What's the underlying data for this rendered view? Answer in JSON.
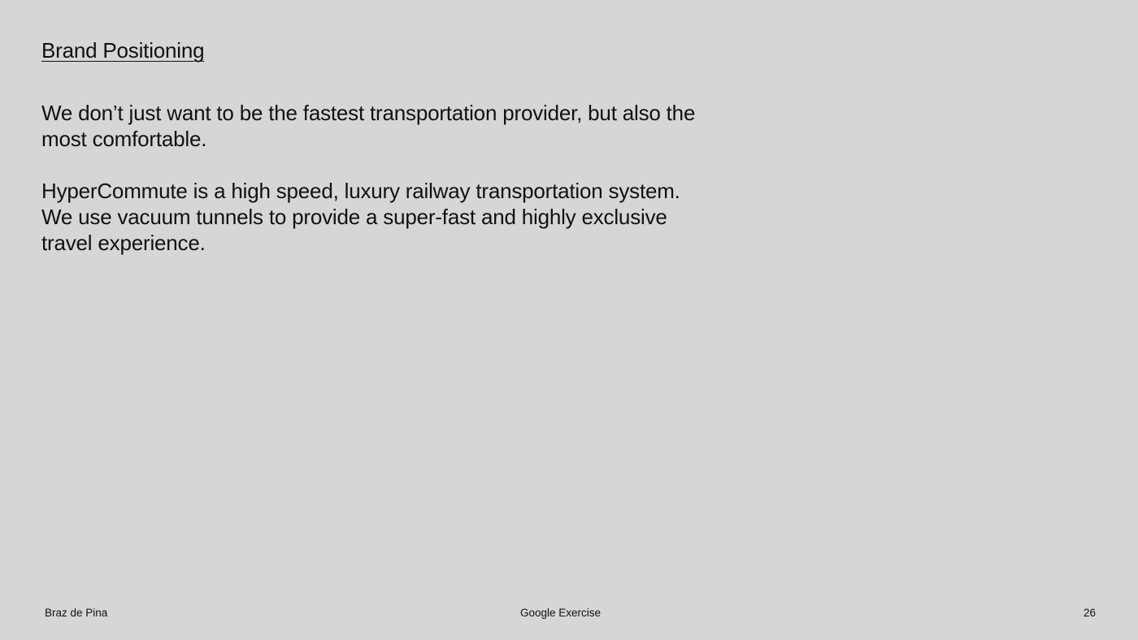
{
  "slide": {
    "title": "Brand Positioning",
    "paragraph_1_line_1": "We don’t just want to be the fastest transportation provider, but also the",
    "paragraph_1_line_2": "most comfortable.",
    "paragraph_2_line_1": "HyperCommute is a high speed, luxury railway transportation system.",
    "paragraph_2_line_2": "We use vacuum tunnels to provide a super-fast and highly exclusive",
    "paragraph_2_line_3": "travel experience."
  },
  "footer": {
    "author": "Braz de Pina",
    "project": "Google Exercise",
    "page_number": "26"
  },
  "colors": {
    "background": "#d6d6d6",
    "text": "#111111"
  }
}
